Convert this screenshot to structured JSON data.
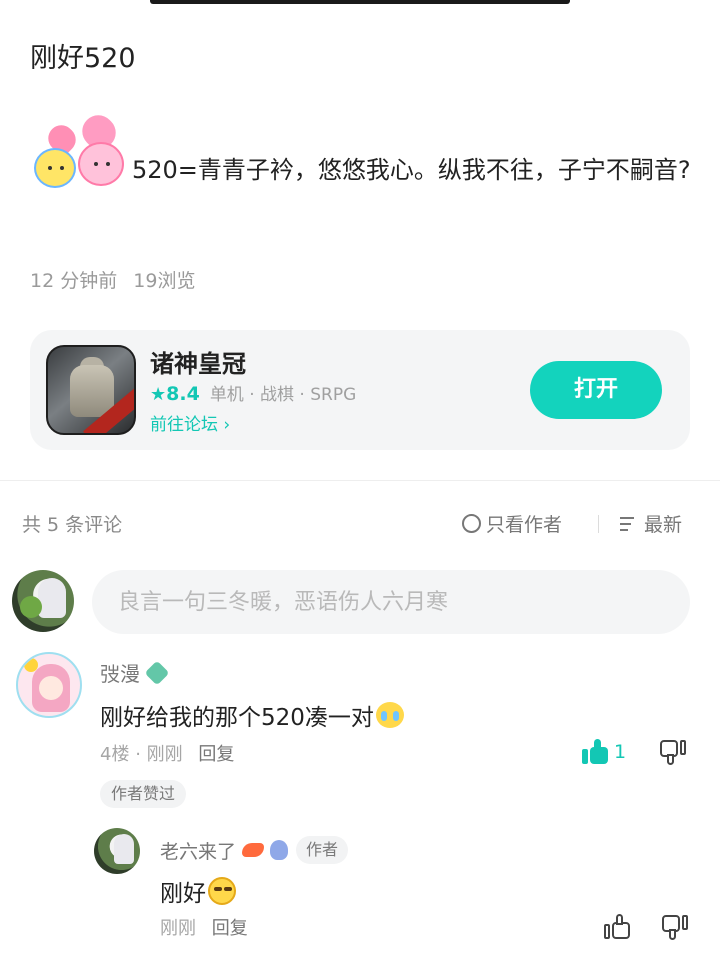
{
  "post": {
    "title": "刚好520",
    "body": "520=青青子衿，悠悠我心。纵我不往，子宁不嗣音?",
    "time": "12 分钟前",
    "views": "19浏览"
  },
  "game_card": {
    "name": "诸神皇冠",
    "rating": "8.4",
    "tags": "单机 · 战棋 · SRPG",
    "forum_link": "前往论坛",
    "open_label": "打开",
    "accent": "#13d3bd"
  },
  "comments_header": {
    "count_label": "共 5 条评论",
    "only_author_label": "只看作者",
    "sort_label": "最新"
  },
  "comment_input": {
    "placeholder": "良言一句三冬暖，恶语伤人六月寒"
  },
  "comments": [
    {
      "user": "弢漫",
      "text": "刚好给我的那个520凑一对",
      "floor": "4楼",
      "time": "刚刚",
      "reply_label": "回复",
      "likes": "1",
      "badge": "作者赞过",
      "emoji": "crying-face-icon"
    }
  ],
  "replies": [
    {
      "user": "老六来了",
      "tag": "作者",
      "text": "刚好",
      "time": "刚刚",
      "reply_label": "回复",
      "emoji": "smile-face-icon"
    }
  ]
}
